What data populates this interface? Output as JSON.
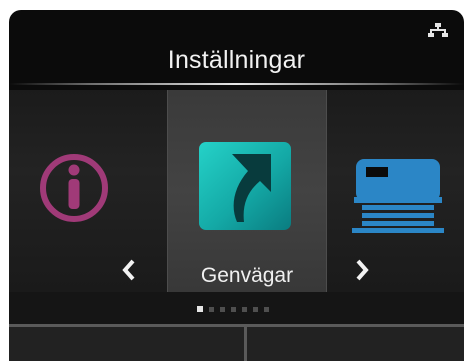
{
  "header": {
    "title": "Inställningar"
  },
  "status_bar": {
    "icon": "network-icon"
  },
  "carousel": {
    "items": [
      {
        "icon": "info-icon",
        "label": "",
        "color": "#a03a78"
      },
      {
        "icon": "shortcut-icon",
        "label": "Genvägar",
        "color": "#17b3b0",
        "selected": true
      },
      {
        "icon": "printer-icon",
        "label": "",
        "color": "#2b86c6"
      }
    ],
    "prev_arrow": "chevron-left-icon",
    "next_arrow": "chevron-right-icon"
  },
  "page_indicator": {
    "total": 7,
    "current": 1
  },
  "softkeys": {
    "left_label": "",
    "right_label": ""
  }
}
